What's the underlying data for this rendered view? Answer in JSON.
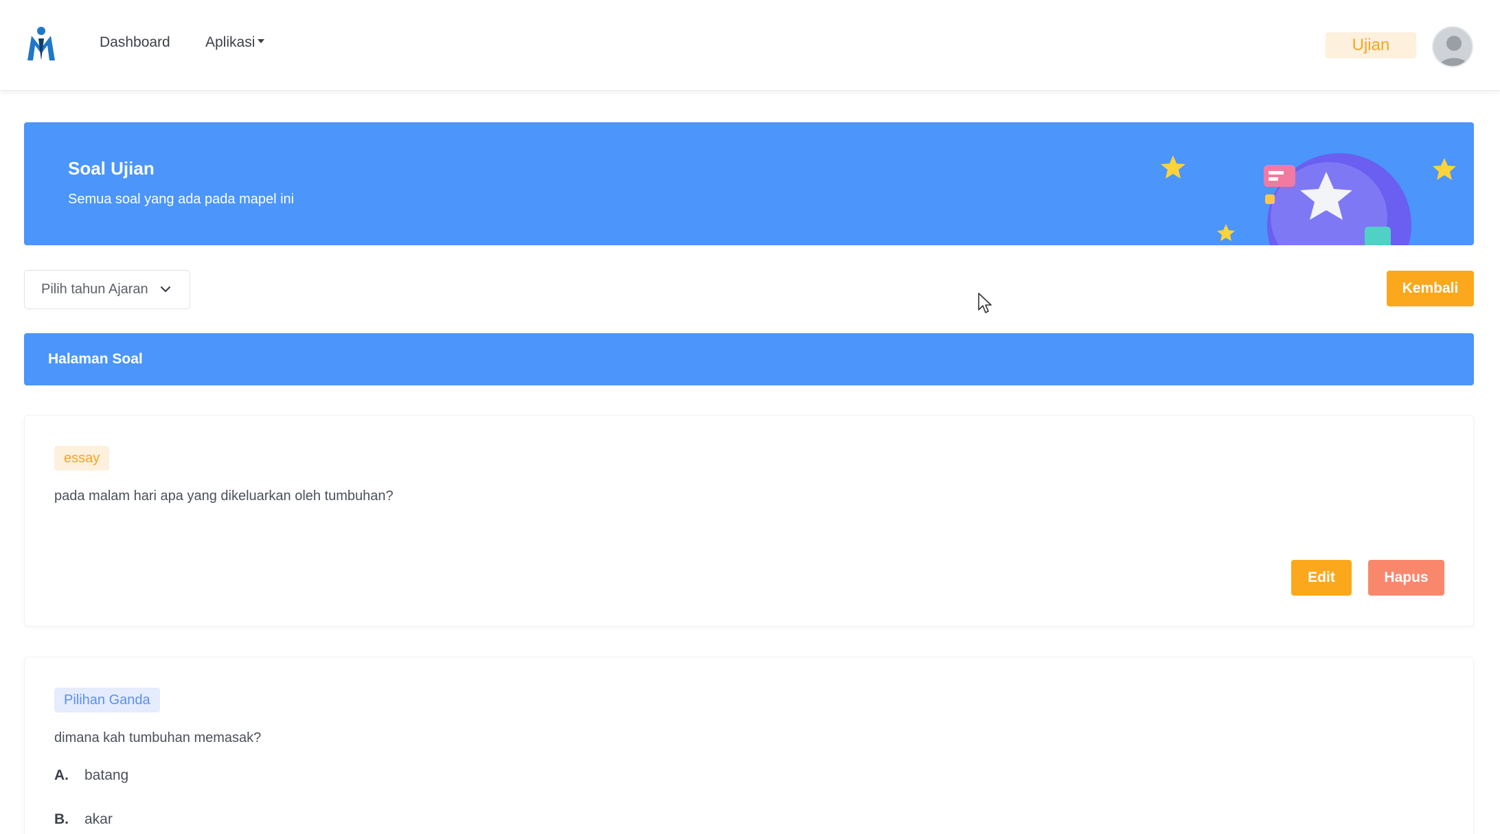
{
  "navbar": {
    "links": [
      {
        "label": "Dashboard"
      },
      {
        "label": "Aplikasi"
      }
    ],
    "badge": "Ujian"
  },
  "banner": {
    "title": "Soal Ujian",
    "subtitle": "Semua soal yang ada pada mapel ini"
  },
  "toolbar": {
    "select_placeholder": "Pilih tahun Ajaran",
    "back_label": "Kembali"
  },
  "section": {
    "title": "Halaman Soal"
  },
  "questions": [
    {
      "type": "essay",
      "text": "pada malam hari apa yang dikeluarkan oleh tumbuhan?",
      "edit_label": "Edit",
      "delete_label": "Hapus"
    },
    {
      "type": "Pilihan Ganda",
      "text": "dimana kah tumbuhan memasak?",
      "options": [
        {
          "letter": "A.",
          "text": "batang"
        },
        {
          "letter": "B.",
          "text": "akar"
        }
      ]
    }
  ],
  "colors": {
    "primary_blue": "#4b95fb",
    "orange": "#fba81c",
    "salmon": "#f9876c"
  },
  "icons": [
    "logo-icon",
    "caret-down-icon",
    "avatar-icon",
    "chevron-down-icon",
    "mouse-cursor-icon"
  ]
}
